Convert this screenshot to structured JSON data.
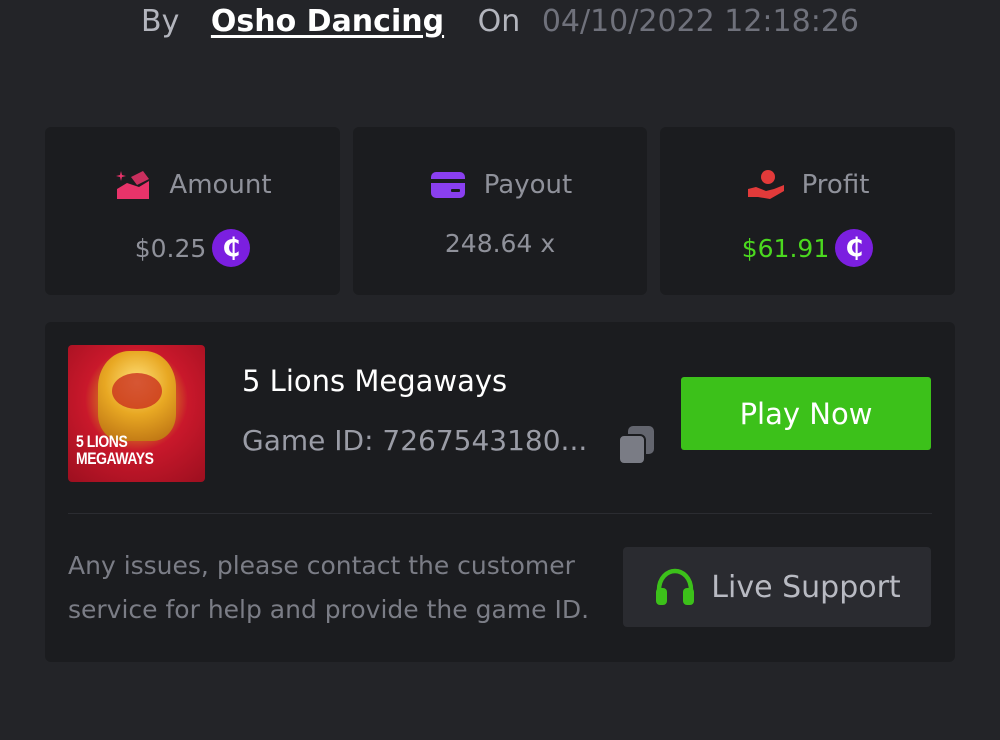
{
  "byline": {
    "by_label": "By",
    "username": "Osho Dancing",
    "on_label": "On",
    "datetime": "04/10/2022 12:18:26"
  },
  "stats": {
    "amount": {
      "label": "Amount",
      "value": "$0.25",
      "icon": "coins-hand-icon",
      "icon_color": "#e8336a",
      "currency_icon": "coin-c-icon"
    },
    "payout": {
      "label": "Payout",
      "value": "248.64 x",
      "icon": "credit-card-icon",
      "icon_color": "#8a3ff0"
    },
    "profit": {
      "label": "Profit",
      "value": "$61.91",
      "icon": "hand-receive-icon",
      "icon_color": "#e23a3a",
      "value_color": "#4bd81f",
      "currency_icon": "coin-c-icon"
    }
  },
  "currency_symbol": "₵",
  "game": {
    "thumbnail_text": "5 LIONS\nMEGAWAYS",
    "name": "5 Lions Megaways",
    "id_text": "Game ID: 7267543180...",
    "play_button": "Play Now"
  },
  "support": {
    "help_text": "Any issues, please contact the customer service for help and provide the game ID.",
    "button_label": "Live Support",
    "icon": "headset-icon",
    "icon_color": "#3cc11a"
  },
  "colors": {
    "background": "#232428",
    "card": "#1b1c1f",
    "accent_green": "#3cc11a",
    "coin_purple": "#7b1fe0"
  }
}
